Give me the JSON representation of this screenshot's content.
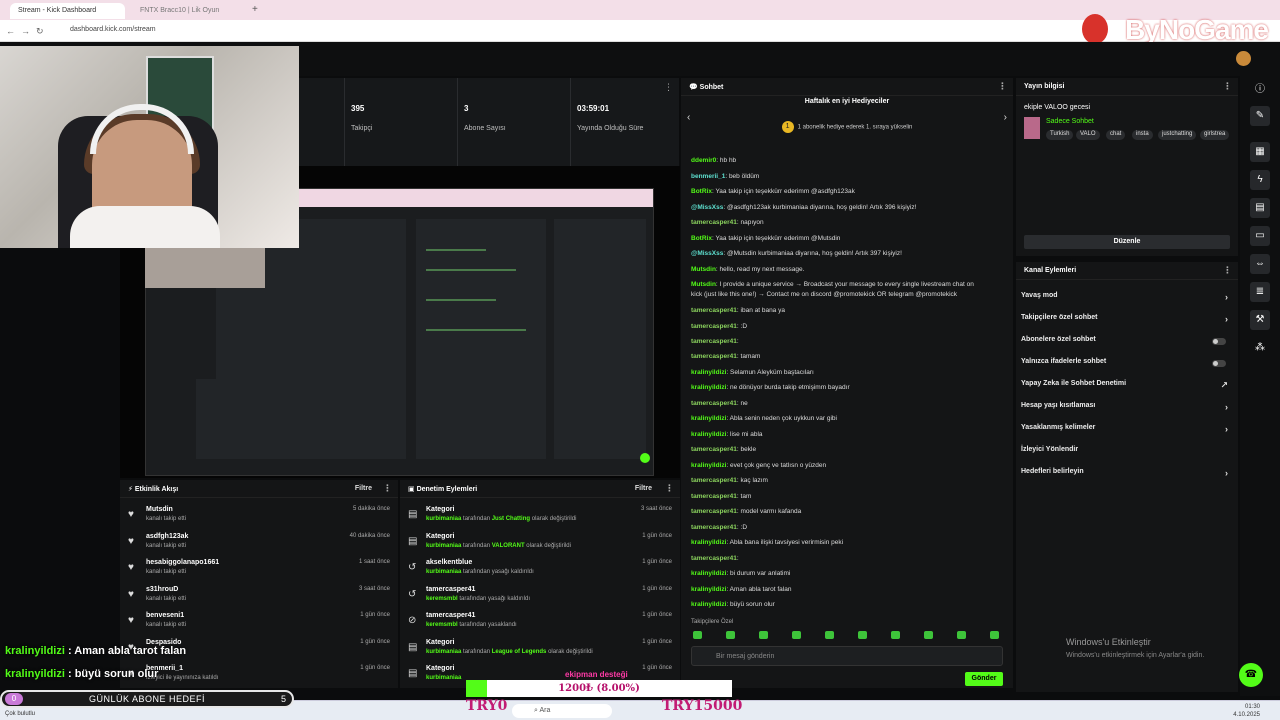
{
  "browser": {
    "tabs": [
      {
        "label": "Stream - Kick Dashboard"
      },
      {
        "label": "FNTX Bracc10 | Lik Oyun"
      }
    ],
    "url": "dashboard.kick.com/stream"
  },
  "watermark": "ByNoGame",
  "stats": [
    {
      "value": "395",
      "label": "Takipçi"
    },
    {
      "value": "3",
      "label": "Abone Sayısı"
    },
    {
      "value": "03:59:01",
      "label": "Yayında Olduğu Süre"
    }
  ],
  "activity": {
    "title": "Etkinlik Akışı",
    "filter": "Filtre",
    "items": [
      {
        "name": "Mutsdin",
        "sub": "kanalı takip etti",
        "time": "5 dakika önce"
      },
      {
        "name": "asdfgh123ak",
        "sub": "kanalı takip etti",
        "time": "40 dakika önce"
      },
      {
        "name": "hesabiggolanapo1661",
        "sub": "kanalı takip etti",
        "time": "1 saat önce"
      },
      {
        "name": "s31hrouD",
        "sub": "kanalı takip etti",
        "time": "3 saat önce"
      },
      {
        "name": "benveseni1",
        "sub": "kanalı takip etti",
        "time": "1 gün önce"
      },
      {
        "name": "Despasido",
        "sub": "",
        "time": "1 gün önce"
      },
      {
        "name": "benmerii_1",
        "sub": "İzleyici ile yayınınıza katıldı",
        "time": "1 gün önce"
      }
    ]
  },
  "moderation": {
    "title": "Denetim Eylemleri",
    "filter": "Filtre",
    "items": [
      {
        "name": "Kategori",
        "actor": "kurbimaniaa",
        "mid": " tarafından ",
        "target": "Just Chatting",
        "end": " olarak değiştirildi",
        "time": "3 saat önce",
        "icon": "category-icon"
      },
      {
        "name": "Kategori",
        "actor": "kurbimaniaa",
        "mid": " tarafından ",
        "target": "VALORANT",
        "end": " olarak değiştirildi",
        "time": "1 gün önce",
        "icon": "category-icon"
      },
      {
        "name": "akselkentblue",
        "actor": "kurbimaniaa",
        "mid": " tarafından yasağı kaldırıldı",
        "target": "",
        "end": "",
        "time": "1 gün önce",
        "icon": "unban-icon"
      },
      {
        "name": "tamercasper41",
        "actor": "keremsmbl",
        "mid": " tarafından yasağı kaldırıldı",
        "target": "",
        "end": "",
        "time": "1 gün önce",
        "icon": "unban-icon"
      },
      {
        "name": "tamercasper41",
        "actor": "keremsmbl",
        "mid": " tarafından yasaklandı",
        "target": "",
        "end": "",
        "time": "1 gün önce",
        "icon": "ban-icon"
      },
      {
        "name": "Kategori",
        "actor": "kurbimaniaa",
        "mid": " tarafından ",
        "target": "League of Legends",
        "end": " olarak değiştirildi",
        "time": "1 gün önce",
        "icon": "category-icon"
      },
      {
        "name": "Kategori",
        "actor": "kurbimaniaa",
        "mid": "",
        "target": "",
        "end": "",
        "time": "1 gün önce",
        "icon": "category-icon"
      }
    ]
  },
  "chat": {
    "title": "Sohbet",
    "gifter_title": "Haftalık en iyi Hediyeciler",
    "gifter_badge": "1",
    "gifter_sub": "1 abonelik hediye ederek 1. sıraya yükselin",
    "messages": [
      {
        "user": "ddemir0",
        "text": ": hb hb",
        "color": "u-green"
      },
      {
        "user": "benmerii_1",
        "text": ": beb öldüm",
        "color": "u-cyan"
      },
      {
        "user": "BotRix",
        "text": ": Yaa takip için teşekkürr ederimm @asdfgh123ak",
        "color": "u-green"
      },
      {
        "user": "@MissXss",
        "text": ": @asdfgh123ak kurbimaniaa diyarına, hoş geldin! Artık 396 kişiyiz!",
        "color": "u-cyan"
      },
      {
        "user": "tamercasper41",
        "text": ": napıyon",
        "color": "u-lime"
      },
      {
        "user": "BotRix",
        "text": ": Yaa takip için teşekkürr ederimm @Mutsdin",
        "color": "u-green"
      },
      {
        "user": "@MissXss",
        "text": ": @Mutsdin kurbimaniaa diyarına, hoş geldin! Artık 397 kişiyiz!",
        "color": "u-cyan"
      },
      {
        "user": "Mutsdin",
        "text": ": hello, read my next message.",
        "color": "u-green"
      },
      {
        "user": "Mutsdin",
        "text": ": I provide a unique service → Broadcast your message to every single livestream chat on",
        "color": "u-green"
      },
      {
        "user": "",
        "text": "kick (just like this one!) → Contact me on discord @promotekick OR telegram @promotekick",
        "color": "u-green"
      },
      {
        "user": "tamercasper41",
        "text": ": iban at bana ya",
        "color": "u-lime"
      },
      {
        "user": "tamercasper41",
        "text": ": :D",
        "color": "u-lime"
      },
      {
        "user": "tamercasper41",
        "text": ":",
        "color": "u-lime"
      },
      {
        "user": "tamercasper41",
        "text": ": tamam",
        "color": "u-lime"
      },
      {
        "user": "kralinyildizi",
        "text": ": Selamun Aleyküm baştacıları",
        "color": "u-green"
      },
      {
        "user": "kralinyildizi",
        "text": ": ne dönüyor burda takip etmişimm bayadır",
        "color": "u-green"
      },
      {
        "user": "tamercasper41",
        "text": ": ne",
        "color": "u-lime"
      },
      {
        "user": "kralinyildizi",
        "text": ": Abla senin neden çok uykkun var gibi",
        "color": "u-green"
      },
      {
        "user": "kralinyildizi",
        "text": ": lise mi abla",
        "color": "u-green"
      },
      {
        "user": "tamercasper41",
        "text": ": bekle",
        "color": "u-lime"
      },
      {
        "user": "kralinyildizi",
        "text": ": evet çok genç ve tatlısn o yüzden",
        "color": "u-green"
      },
      {
        "user": "tamercasper41",
        "text": ": kaç lazım",
        "color": "u-lime"
      },
      {
        "user": "tamercasper41",
        "text": ": tam",
        "color": "u-lime"
      },
      {
        "user": "tamercasper41",
        "text": ": model varmı kafanda",
        "color": "u-lime"
      },
      {
        "user": "tamercasper41",
        "text": ": :D",
        "color": "u-lime"
      },
      {
        "user": "kralinyildizi",
        "text": ": Abla bana ilişki tavsiyesi verirmisin peki",
        "color": "u-green"
      },
      {
        "user": "tamercasper41",
        "text": ":",
        "color": "u-lime"
      },
      {
        "user": "kralinyildizi",
        "text": ": bi durum var anlatimi",
        "color": "u-green"
      },
      {
        "user": "kralinyildizi",
        "text": ": Aman abla tarot falan",
        "color": "u-green"
      },
      {
        "user": "kralinyildizi",
        "text": ": büyü sorun olur",
        "color": "u-green"
      }
    ],
    "follower_only": "Takipçilere Özel",
    "input_placeholder": "Bir mesaj gönderin",
    "send_label": "Gönder"
  },
  "stream_info": {
    "title": "Yayın bilgisi",
    "stream_title": "ekiple VALOO gecesi",
    "category": "Sadece Sohbet",
    "tags": [
      "Turkish",
      "VALO",
      "chat",
      "insta",
      "justchatting",
      "girlstrea"
    ],
    "edit_label": "Düzenle"
  },
  "channel_actions": {
    "title": "Kanal Eylemleri",
    "items": [
      {
        "label": "Yavaş mod",
        "kind": "chevron"
      },
      {
        "label": "Takipçilere özel sohbet",
        "kind": "chevron"
      },
      {
        "label": "Abonelere özel sohbet",
        "kind": "toggle"
      },
      {
        "label": "Yalnızca ifadelerle sohbet",
        "kind": "toggle"
      },
      {
        "label": "Yapay Zeka ile Sohbet Denetimi",
        "kind": "external"
      },
      {
        "label": "Hesap yaşı kısıtlaması",
        "kind": "chevron"
      },
      {
        "label": "Yasaklanmış kelimeler",
        "kind": "chevron"
      },
      {
        "label": "İzleyici Yönlendir",
        "kind": "none"
      },
      {
        "label": "Hedefleri belirleyin",
        "kind": "chevron"
      }
    ]
  },
  "windows_activation": {
    "title": "Windows'u Etkinleştir",
    "sub": "Windows'u etkinleştirmek için Ayarlar'a gidin."
  },
  "overlay": {
    "chat_lines": [
      {
        "user": "kralinyildizi",
        "text": " : Aman abla tarot falan"
      },
      {
        "user": "kralinyildizi",
        "text": " : büyü sorun olur"
      }
    ],
    "goal_label": "GÜNLÜK ABONE HEDEFİ",
    "goal_current": "0",
    "goal_target": "5",
    "goal_progress": 0,
    "donation_title": "ekipman desteği",
    "donation_text": "1200₺ (8.00%)",
    "donation_progress": 0.08,
    "donation_min": "TRY0",
    "donation_max": "TRY15000"
  },
  "taskbar": {
    "weather": "Çok bulutlu",
    "search": "Ara",
    "time": "01:30",
    "date": "4.10.2025"
  }
}
